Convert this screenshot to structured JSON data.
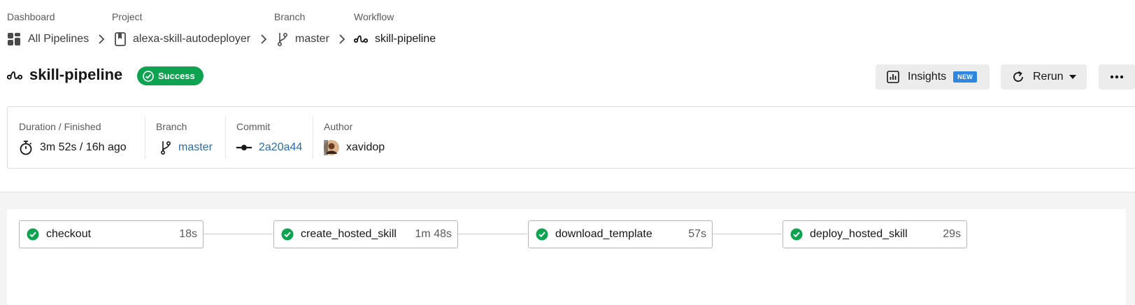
{
  "breadcrumb": {
    "dashboard": {
      "label": "Dashboard",
      "value": "All Pipelines"
    },
    "project": {
      "label": "Project",
      "value": "alexa-skill-autodeployer"
    },
    "branch": {
      "label": "Branch",
      "value": "master"
    },
    "workflow": {
      "label": "Workflow",
      "value": "skill-pipeline"
    }
  },
  "header": {
    "title": "skill-pipeline",
    "status": "Success",
    "insights_label": "Insights",
    "new_tag": "NEW",
    "rerun_label": "Rerun"
  },
  "meta": {
    "duration": {
      "label": "Duration / Finished",
      "value": "3m 52s / 16h ago"
    },
    "branch": {
      "label": "Branch",
      "value": "master"
    },
    "commit": {
      "label": "Commit",
      "value": "2a20a44"
    },
    "author": {
      "label": "Author",
      "value": "xavidop"
    }
  },
  "jobs": [
    {
      "name": "checkout",
      "duration": "18s",
      "status": "success"
    },
    {
      "name": "create_hosted_skill",
      "duration": "1m 48s",
      "status": "success"
    },
    {
      "name": "download_template",
      "duration": "57s",
      "status": "success"
    },
    {
      "name": "deploy_hosted_skill",
      "duration": "29s",
      "status": "success"
    }
  ],
  "colors": {
    "success": "#0ea350",
    "link": "#2b6cb0",
    "new_tag": "#2e86de"
  }
}
